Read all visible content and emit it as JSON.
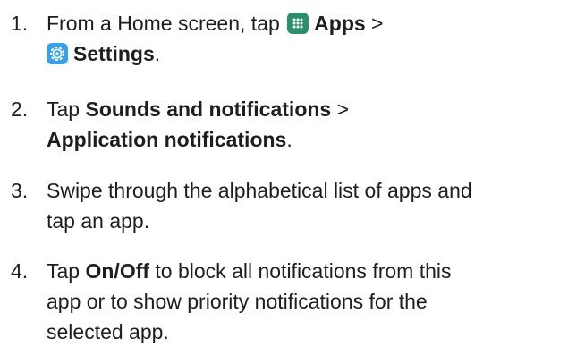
{
  "steps": [
    {
      "number": "1.",
      "line1_pre": "From a Home screen, tap",
      "apps_label": "Apps",
      "line1_post": ">",
      "settings_label": "Settings",
      "settings_post": "."
    },
    {
      "number": "2.",
      "pre": "Tap",
      "sounds_label": "Sounds and notifications",
      "sep": ">",
      "app_notif_label": "Application notifications",
      "post": "."
    },
    {
      "number": "3.",
      "line1": "Swipe through the alphabetical list of apps and",
      "line2": "tap an app."
    },
    {
      "number": "4.",
      "pre": "Tap",
      "onoff_label": "On/Off",
      "line1_post": "to block all notifications from this",
      "line2": "app or to show priority notifications for the",
      "line3": "selected app."
    }
  ],
  "colors": {
    "text": "#1e1e1e",
    "apps_icon_bg": "#2c8f6b",
    "settings_icon_bg": "#3ba1e6"
  },
  "icons": {
    "apps": "apps-grid-icon",
    "settings": "settings-gear-icon"
  }
}
